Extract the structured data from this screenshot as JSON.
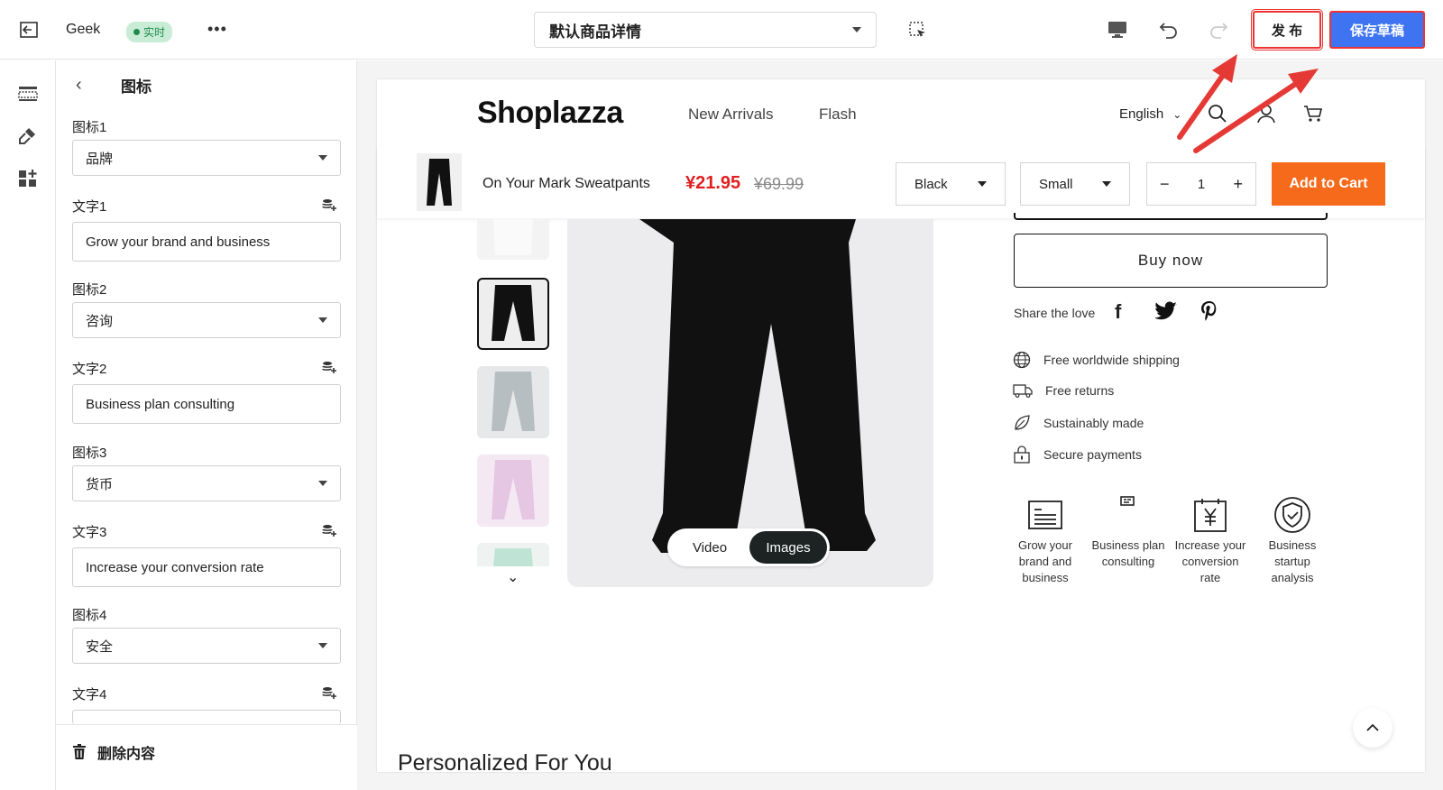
{
  "topbar": {
    "theme_name": "Geek",
    "live_badge": "实时",
    "page_select_value": "默认商品详情",
    "publish_label": "发 布",
    "save_draft_label": "保存草稿"
  },
  "panel": {
    "title": "图标",
    "fields": [
      {
        "icon_label": "图标1",
        "icon_value": "品牌",
        "text_label": "文字1",
        "text_value": "Grow your brand and business"
      },
      {
        "icon_label": "图标2",
        "icon_value": "咨询",
        "text_label": "文字2",
        "text_value": "Business plan consulting"
      },
      {
        "icon_label": "图标3",
        "icon_value": "货币",
        "text_label": "文字3",
        "text_value": "Increase your conversion rate"
      },
      {
        "icon_label": "图标4",
        "icon_value": "安全",
        "text_label": "文字4",
        "text_value": ""
      }
    ],
    "delete_label": "删除内容"
  },
  "store": {
    "logo": "Shoplazza",
    "nav": [
      "New Arrivals",
      "Flash"
    ],
    "language": "English",
    "sticky": {
      "product_name": "On Your Mark Sweatpants",
      "price": "¥21.95",
      "compare_price": "¥69.99",
      "color": "Black",
      "size": "Small",
      "quantity": "1",
      "add_to_cart": "Add to Cart"
    },
    "media_tabs": [
      "Video",
      "Images"
    ],
    "buy_now": "Buy now",
    "share_label": "Share the love",
    "features": [
      "Free worldwide shipping",
      "Free returns",
      "Sustainably made",
      "Secure payments"
    ],
    "icon_tiles": [
      "Grow your brand and business",
      "Business plan consulting",
      "Increase your conversion rate",
      "Business startup analysis"
    ],
    "section_title": "Personalized For You"
  },
  "colors": {
    "accent_blue": "#3e74f2",
    "highlight_red": "#e33333",
    "cart_orange": "#f56a1b",
    "price_red": "#e02020",
    "live_green": "#1f8a4c"
  }
}
